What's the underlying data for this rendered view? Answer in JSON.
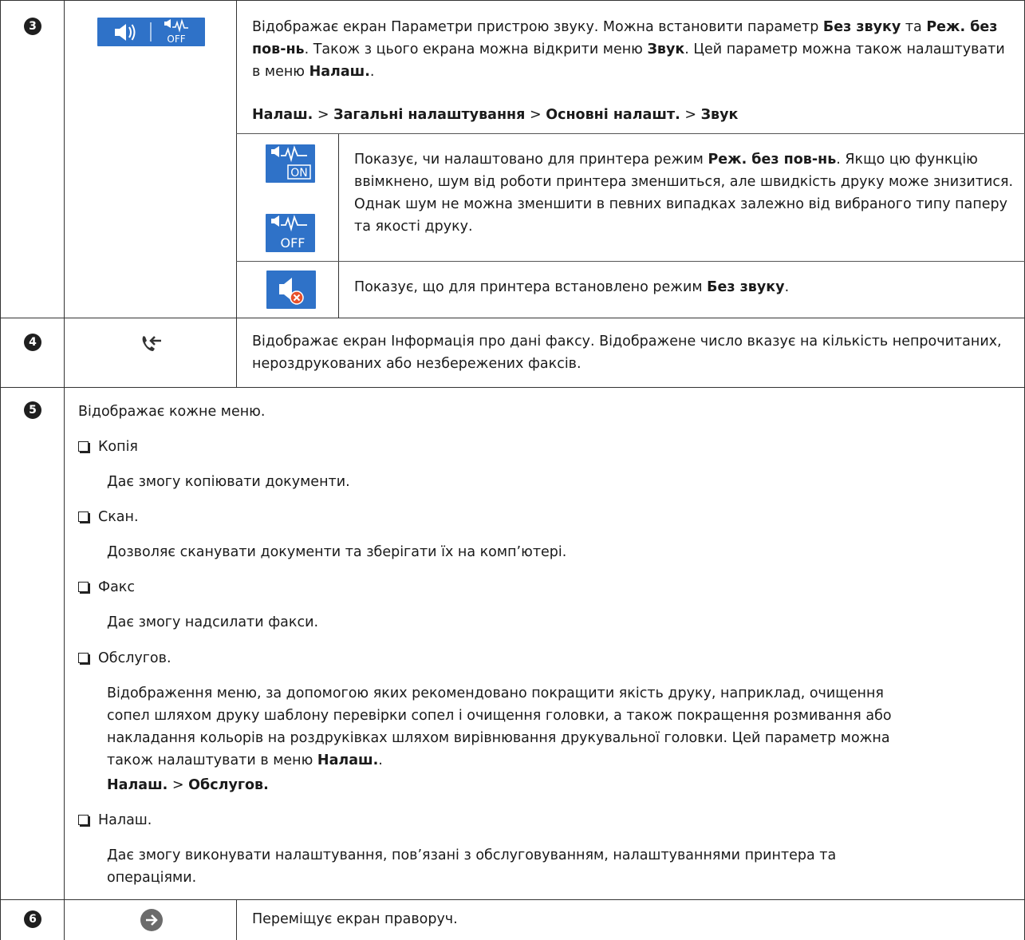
{
  "rows": {
    "r3": {
      "number": "3",
      "desc_parts": [
        "Відображає екран Параметри пристрою звуку. Можна встановити параметр ",
        "Без звуку",
        " та ",
        "Реж. без пов-нь",
        ". Також з цього екрана можна відкрити меню ",
        "Звук",
        ". Цей параметр можна також налаштувати в меню ",
        "Налаш.",
        "."
      ],
      "path": [
        "Налаш.",
        ">",
        "Загальні налаштування",
        ">",
        "Основні налашт.",
        ">",
        "Звук"
      ],
      "icons": [
        "speaker-icon",
        "quiet-mode-off-icon"
      ],
      "sub": [
        {
          "icons": [
            "quiet-mode-on-icon",
            "quiet-mode-off-icon"
          ],
          "icon_text": [
            "ON",
            "OFF"
          ],
          "parts": [
            "Показує, чи налаштовано для принтера режим ",
            "Реж. без пов-нь",
            ". Якщо цю функцію ввімкнено, шум від роботи принтера зменшиться, але швидкість друку може знизитися. Однак шум не можна зменшити в певних випадках залежно від вибраного типу паперу та якості друку."
          ]
        },
        {
          "icons": [
            "mute-icon"
          ],
          "parts": [
            "Показує, що для принтера встановлено режим ",
            "Без звуку",
            "."
          ]
        }
      ]
    },
    "r4": {
      "number": "4",
      "icon": "fax-incoming-icon",
      "desc": "Відображає екран Інформація про дані факсу. Відображене число вказує на кількість непрочитаних, нероздрукованих або незбережених факсів."
    },
    "r5": {
      "number": "5",
      "intro": "Відображає кожне меню.",
      "items": [
        {
          "label": "Копія",
          "desc": "Дає змогу копіювати документи."
        },
        {
          "label": "Скан.",
          "desc": "Дозволяє сканувати документи та зберігати їх на комп’ютері."
        },
        {
          "label": "Факс",
          "desc": "Дає змогу надсилати факси."
        },
        {
          "label": "Обслугов.",
          "desc_parts": [
            "Відображення меню, за допомогою яких рекомендовано покращити якість друку, наприклад, очищення сопел шляхом друку шаблону перевірки сопел і очищення головки, а також покращення розмивання або накладання кольорів на роздруківках шляхом вирівнювання друкувальної головки. Цей параметр можна також налаштувати в меню ",
            "Налаш.",
            "."
          ],
          "path": [
            "Налаш.",
            ">",
            "Обслугов."
          ]
        },
        {
          "label": "Налаш.",
          "desc": "Дає змогу виконувати налаштування, пов’язані з обслуговуванням, налаштуваннями принтера та операціями."
        }
      ]
    },
    "r6": {
      "number": "6",
      "icon": "arrow-right-icon",
      "desc": "Переміщує екран праворуч."
    }
  },
  "colors": {
    "icon_blue": "#2f72c8",
    "icon_red": "#e8502a",
    "icon_grey": "#6b6b6b"
  }
}
